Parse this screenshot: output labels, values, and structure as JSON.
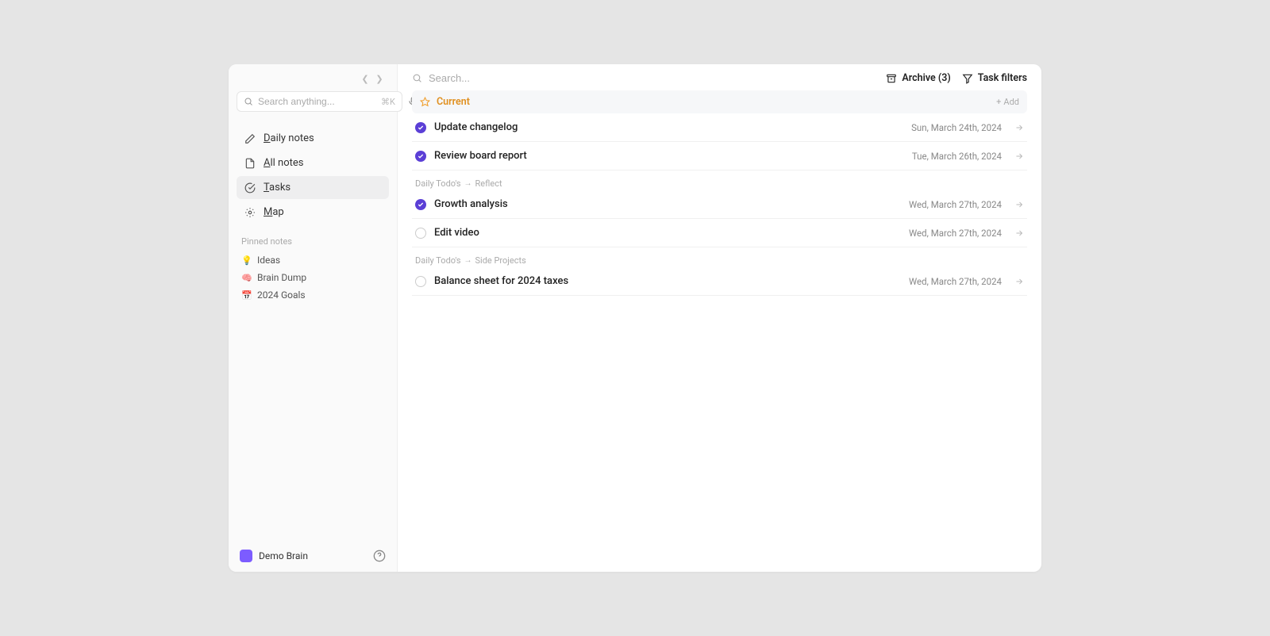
{
  "sidebar": {
    "search_placeholder": "Search anything...",
    "search_shortcut": "⌘K",
    "nav": [
      {
        "id": "daily-notes",
        "label": "Daily notes"
      },
      {
        "id": "all-notes",
        "label": "All notes"
      },
      {
        "id": "tasks",
        "label": "Tasks"
      },
      {
        "id": "map",
        "label": "Map"
      }
    ],
    "pinned_label": "Pinned notes",
    "pinned": [
      {
        "emoji": "💡",
        "label": "Ideas"
      },
      {
        "emoji": "🧠",
        "label": "Brain Dump"
      },
      {
        "emoji": "📅",
        "label": "2024 Goals"
      }
    ],
    "brain_name": "Demo Brain"
  },
  "topbar": {
    "search_placeholder": "Search...",
    "archive_label": "Archive (3)",
    "filters_label": "Task filters"
  },
  "section": {
    "title": "Current",
    "add_label": "Add"
  },
  "groups": [
    {
      "breadcrumb": null,
      "tasks": [
        {
          "done": true,
          "title": "Update changelog",
          "date": "Sun, March 24th, 2024"
        },
        {
          "done": true,
          "title": "Review board report",
          "date": "Tue, March 26th, 2024"
        }
      ]
    },
    {
      "breadcrumb": [
        "Daily Todo's",
        "Reflect"
      ],
      "tasks": [
        {
          "done": true,
          "title": "Growth analysis",
          "date": "Wed, March 27th, 2024"
        },
        {
          "done": false,
          "title": "Edit video",
          "date": "Wed, March 27th, 2024"
        }
      ]
    },
    {
      "breadcrumb": [
        "Daily Todo's",
        "Side Projects"
      ],
      "tasks": [
        {
          "done": false,
          "title": "Balance sheet for 2024 taxes",
          "date": "Wed, March 27th, 2024"
        }
      ]
    }
  ]
}
